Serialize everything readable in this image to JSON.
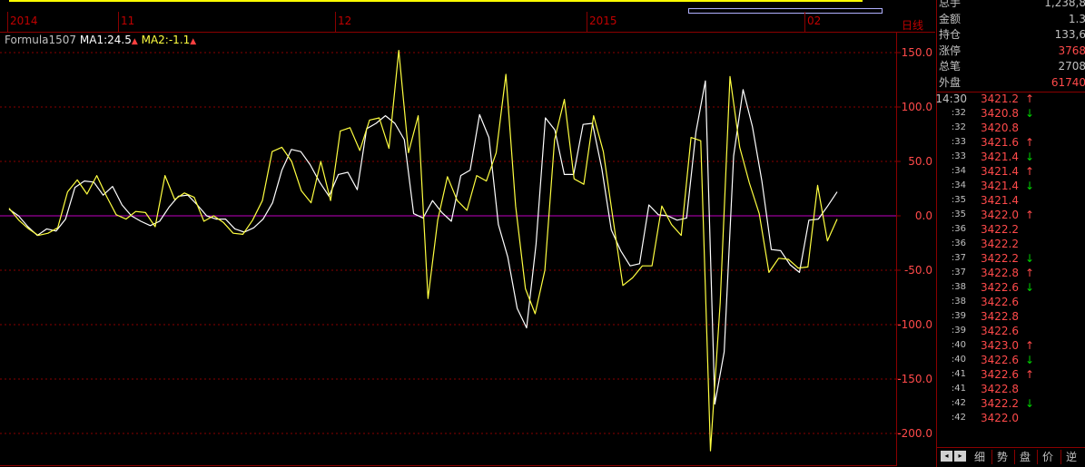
{
  "timeline": {
    "ticks": [
      "2014",
      "11",
      "12",
      "2015",
      "02"
    ],
    "period_label": "日线"
  },
  "indicator": {
    "name": "Formula1507",
    "ma1_label": "MA1:24.5",
    "ma2_label": "MA2:-1.1",
    "ma1_color": "#ffffff",
    "ma2_color": "#ffff40",
    "arrow_color": "#ff4040"
  },
  "colors": {
    "grid": "#8a0000",
    "axis_text": "#ff4a4a",
    "zero_line": "#c000c0",
    "up": "#ff4a4a",
    "down": "#00d000",
    "yellow_bar": "#ffff00"
  },
  "chart_data": {
    "type": "line",
    "ylim": [
      -230,
      160
    ],
    "y_ticks": [
      "150.0",
      "100.0",
      "50.0",
      "0.0",
      "-50.0",
      "-100.0",
      "-150.0",
      "-200.0"
    ],
    "y_tick_values": [
      150,
      100,
      50,
      0,
      -50,
      -100,
      -150,
      -200
    ],
    "series": [
      {
        "name": "MA1",
        "color": "#ffffff",
        "values": [
          6,
          0,
          -10,
          -18,
          -12,
          -14,
          -3,
          26,
          32,
          31,
          19,
          27,
          10,
          0,
          -5,
          -9,
          -5,
          8,
          18,
          19,
          10,
          0,
          -3,
          -3,
          -12,
          -15,
          -11,
          -3,
          12,
          42,
          61,
          59,
          47,
          31,
          18,
          38,
          40,
          24,
          80,
          85,
          92,
          85,
          70,
          2,
          -2,
          14,
          3,
          -5,
          37,
          42,
          93,
          72,
          -8,
          -38,
          -85,
          -103,
          -26,
          90,
          79,
          38,
          38,
          84,
          85,
          43,
          -13,
          -32,
          -46,
          -44,
          10,
          1,
          0,
          -4,
          -2,
          77,
          124,
          -173,
          -125,
          55,
          116,
          82,
          32,
          -31,
          -32,
          -45,
          -52,
          -4,
          -3,
          9,
          22
        ]
      },
      {
        "name": "MA2",
        "color": "#ffff40",
        "values": [
          7,
          -4,
          -12,
          -18,
          -16,
          -11,
          22,
          33,
          20,
          37,
          18,
          1,
          -3,
          4,
          3,
          -10,
          37,
          15,
          21,
          17,
          -5,
          0,
          -6,
          -16,
          -17,
          -4,
          14,
          59,
          63,
          50,
          23,
          12,
          50,
          14,
          78,
          81,
          60,
          88,
          90,
          62,
          152,
          58,
          92,
          -76,
          -4,
          36,
          14,
          5,
          37,
          32,
          58,
          130,
          9,
          -67,
          -90,
          -50,
          70,
          107,
          34,
          29,
          92,
          59,
          -3,
          -64,
          -57,
          -46,
          -46,
          9,
          -8,
          -18,
          72,
          69,
          -216,
          -80,
          128,
          63,
          30,
          2,
          -52,
          -39,
          -40,
          -48,
          -47,
          28,
          -23,
          -3
        ]
      }
    ]
  },
  "quote": {
    "rows": [
      {
        "label": "总手",
        "value": "1,238,8",
        "color": "#c0c0c0"
      },
      {
        "label": "金额",
        "value": "1.3",
        "color": "#c0c0c0"
      },
      {
        "label": "持仓",
        "value": "133,6",
        "color": "#c0c0c0"
      },
      {
        "label": "涨停",
        "value": "3768",
        "color": "#ff4a4a"
      },
      {
        "label": "总笔",
        "value": "2708",
        "color": "#c0c0c0"
      },
      {
        "label": "外盘",
        "value": "61740",
        "color": "#ff4a4a"
      }
    ]
  },
  "ticks_list": [
    {
      "time": "14:30",
      "price": "3421.2",
      "arrow": "↑"
    },
    {
      "time": ":32",
      "price": "3420.8",
      "arrow": "↓"
    },
    {
      "time": ":32",
      "price": "3420.8",
      "arrow": ""
    },
    {
      "time": ":33",
      "price": "3421.6",
      "arrow": "↑"
    },
    {
      "time": ":33",
      "price": "3421.4",
      "arrow": "↓"
    },
    {
      "time": ":34",
      "price": "3421.4",
      "arrow": "↑"
    },
    {
      "time": ":34",
      "price": "3421.4",
      "arrow": "↓"
    },
    {
      "time": ":35",
      "price": "3421.4",
      "arrow": ""
    },
    {
      "time": ":35",
      "price": "3422.0",
      "arrow": "↑"
    },
    {
      "time": ":36",
      "price": "3422.2",
      "arrow": ""
    },
    {
      "time": ":36",
      "price": "3422.2",
      "arrow": ""
    },
    {
      "time": ":37",
      "price": "3422.2",
      "arrow": "↓"
    },
    {
      "time": ":37",
      "price": "3422.8",
      "arrow": "↑"
    },
    {
      "time": ":38",
      "price": "3422.6",
      "arrow": "↓"
    },
    {
      "time": ":38",
      "price": "3422.6",
      "arrow": ""
    },
    {
      "time": ":39",
      "price": "3422.8",
      "arrow": ""
    },
    {
      "time": ":39",
      "price": "3422.6",
      "arrow": ""
    },
    {
      "time": ":40",
      "price": "3423.0",
      "arrow": "↑"
    },
    {
      "time": ":40",
      "price": "3422.6",
      "arrow": "↓"
    },
    {
      "time": ":41",
      "price": "3422.6",
      "arrow": "↑"
    },
    {
      "time": ":41",
      "price": "3422.8",
      "arrow": ""
    },
    {
      "time": ":42",
      "price": "3422.2",
      "arrow": "↓"
    },
    {
      "time": ":42",
      "price": "3422.0",
      "arrow": ""
    }
  ],
  "bottom_tabs": {
    "nav_left": "◂",
    "nav_right": "▸",
    "tabs": [
      "细",
      "势",
      "盘",
      "价",
      "逆"
    ]
  }
}
